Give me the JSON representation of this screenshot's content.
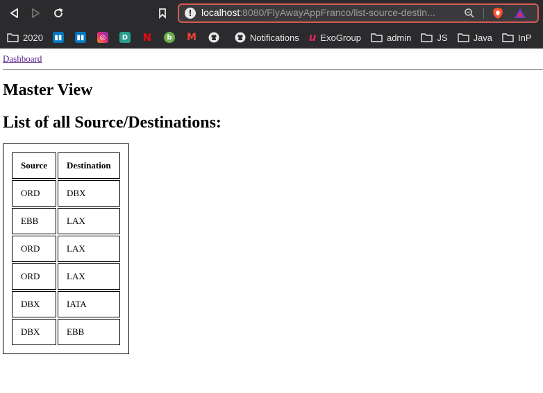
{
  "browser": {
    "url_host": "localhost",
    "url_rest": ":8080/FlyAwayAppFranco/list-source-destin...",
    "bookmarks": [
      {
        "type": "folder",
        "label": "2020"
      },
      {
        "type": "favicon",
        "label": "",
        "icon": "trello-icon",
        "color": "#0079bf",
        "glyph": "▮"
      },
      {
        "type": "favicon",
        "label": "",
        "icon": "trello-icon",
        "color": "#0079bf",
        "glyph": "▮"
      },
      {
        "type": "favicon",
        "label": "",
        "icon": "instagram-icon",
        "color": "#d6249f",
        "glyph": "◎"
      },
      {
        "type": "favicon",
        "label": "",
        "icon": "d-app-icon",
        "color": "#2a9d8f",
        "glyph": "D"
      },
      {
        "type": "favicon",
        "label": "",
        "icon": "netflix-icon",
        "color": "#e50914",
        "glyph": "N"
      },
      {
        "type": "favicon",
        "label": "",
        "icon": "green-app-icon",
        "color": "#6ab04c",
        "glyph": "b"
      },
      {
        "type": "favicon",
        "label": "",
        "icon": "gmail-icon",
        "color": "#ea4335",
        "glyph": "M"
      },
      {
        "type": "favicon",
        "label": "",
        "icon": "github-icon",
        "color": "#333333",
        "glyph": "●"
      },
      {
        "type": "github",
        "label": "Notifications"
      },
      {
        "type": "exo",
        "label": "ExoGroup"
      },
      {
        "type": "folder",
        "label": "admin"
      },
      {
        "type": "folder",
        "label": "JS"
      },
      {
        "type": "folder",
        "label": "Java"
      },
      {
        "type": "folder",
        "label": "InP"
      }
    ]
  },
  "page": {
    "nav_link": "Dashboard",
    "title": "Master View",
    "subtitle": "List of all Source/Destinations:",
    "table": {
      "headers": [
        "Source",
        "Destination"
      ],
      "rows": [
        [
          "ORD",
          "DBX"
        ],
        [
          "EBB",
          "LAX"
        ],
        [
          "ORD",
          "LAX"
        ],
        [
          "ORD",
          "LAX"
        ],
        [
          "DBX",
          "IATA"
        ],
        [
          "DBX",
          "EBB"
        ]
      ]
    }
  }
}
